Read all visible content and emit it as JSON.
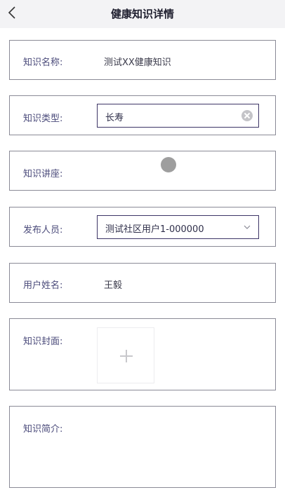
{
  "header": {
    "title": "健康知识详情",
    "back_icon": "chevron-left-icon"
  },
  "form": {
    "name": {
      "label": "知识名称:",
      "value": "测试XX健康知识"
    },
    "type": {
      "label": "知识类型:",
      "value": "长寿",
      "clear_icon": "clear-circle-icon"
    },
    "lecture": {
      "label": "知识讲座:",
      "value": ""
    },
    "publisher": {
      "label": "发布人员:",
      "value": "测试社区用户1-000000",
      "dropdown_icon": "chevron-down-icon"
    },
    "username": {
      "label": "用户姓名:",
      "value": "王毅"
    },
    "cover": {
      "label": "知识封面:",
      "upload_icon": "plus-icon"
    },
    "intro": {
      "label": "知识简介:",
      "value": ""
    }
  },
  "colors": {
    "header_bg": "#f3f3f5",
    "label": "#4a4a7a",
    "input_border": "#3d3566",
    "card_border": "#8a8a96"
  }
}
